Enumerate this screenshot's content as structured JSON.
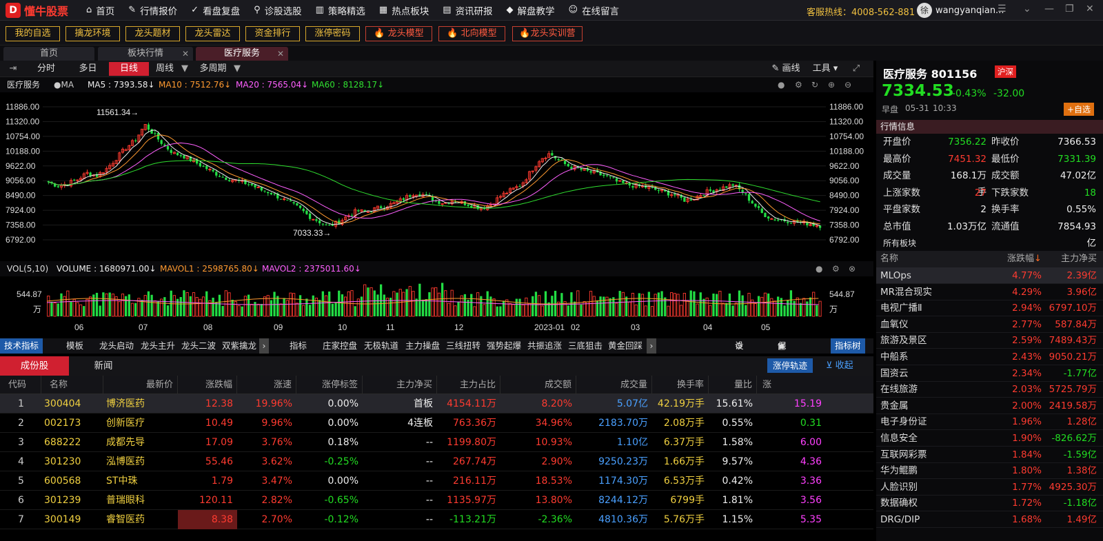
{
  "app": {
    "brand": "懂牛股票",
    "hotline": "客服热线：4008-562-881",
    "username": "wangyanqian...",
    "user_initial": "徐"
  },
  "nav": [
    "首页",
    "行情报价",
    "看盘复盘",
    "诊股选股",
    "策略精选",
    "热点板块",
    "资讯研报",
    "解盘教学",
    "在线留言"
  ],
  "tools": [
    "我的自选",
    "擒龙环境",
    "龙头题材",
    "龙头雷达",
    "资金排行",
    "涨停密码"
  ],
  "promo": [
    "龙头模型",
    "北向模型",
    "龙头实训营"
  ],
  "tabs": [
    "首页",
    "板块行情",
    "医疗服务"
  ],
  "periods": [
    "分时",
    "多日",
    "日线",
    "周线",
    "多周期"
  ],
  "chart_tools": [
    "画线",
    "工具"
  ],
  "ma": {
    "name": "医疗服务",
    "ma_label": "MA",
    "ma5": "MA5 : 7393.58↓",
    "ma10": "MA10 : 7512.76↓",
    "ma20": "MA20 : 7565.04↓",
    "ma60": "MA60 : 8128.17↓"
  },
  "vol": {
    "label": "VOL(5,10)",
    "volume": "VOLUME : 1680971.00↓",
    "mavol1": "MAVOL1 : 2598765.80↓",
    "mavol2": "MAVOL2 : 2375011.60↓",
    "axis_top": "544.87",
    "axis_unit": "万"
  },
  "chart_data": {
    "type": "candlestick",
    "y_ticks": [
      "11886.00",
      "11320.00",
      "10754.00",
      "10188.00",
      "9622.00",
      "9056.00",
      "8490.00",
      "7924.00",
      "7358.00",
      "6792.00"
    ],
    "ylim": [
      6792,
      11886
    ],
    "x_labels": [
      "06",
      "07",
      "08",
      "09",
      "10",
      "11",
      "12",
      "2023-01",
      "02",
      "03",
      "04",
      "05"
    ],
    "annotations": [
      "11561.34",
      "7033.33"
    ],
    "close_path": [
      9000,
      8850,
      8950,
      9100,
      9350,
      9250,
      9500,
      9900,
      10300,
      10600,
      11200,
      10800,
      10400,
      10100,
      10000,
      9800,
      9600,
      9400,
      9200,
      9100,
      9000,
      8900,
      8700,
      8600,
      8400,
      8200,
      8000,
      7700,
      7500,
      7300,
      7450,
      7700,
      7900,
      7850,
      8000,
      8100,
      8200,
      8400,
      8600,
      8500,
      8300,
      8200,
      8300,
      8200,
      8100,
      8000,
      8200,
      8500,
      8700,
      8900,
      9400,
      9900,
      10100,
      9800,
      9600,
      9500,
      9400,
      9300,
      9200,
      9000,
      8900,
      8850,
      8800,
      8700,
      8600,
      8500,
      8300,
      8400,
      8600,
      8700,
      8800,
      8900,
      8600,
      8200,
      7800,
      7600,
      7550,
      7500,
      7450,
      7400,
      7334
    ]
  },
  "indicators": {
    "title": "技术指标",
    "items": [
      "模板",
      "龙头启动",
      "龙头主升",
      "龙头二波",
      "双紫擒龙"
    ],
    "label2": "指标",
    "items2": [
      "庄家控盘",
      "无极轨道",
      "主力操盘",
      "三线扭转",
      "强势起爆",
      "共振追涨",
      "三底狙击",
      "黄金回踩"
    ],
    "settings": "设置",
    "save": "保存模板",
    "tree": "指标树"
  },
  "table_tabs": [
    "成份股",
    "新闻"
  ],
  "table_actions": {
    "limit": "涨停轨迹",
    "collapse": "收起"
  },
  "table_headers": [
    "代码",
    "名称",
    "最新价",
    "涨跌幅",
    "涨速",
    "涨停标签",
    "主力净买",
    "主力占比",
    "成交额",
    "成交量",
    "换手率",
    "量比",
    "涨"
  ],
  "rows": [
    {
      "i": "1",
      "code": "300404",
      "name": "博济医药",
      "price": "12.38",
      "chg": "19.96%",
      "spd": "0.00%",
      "tag": "首板",
      "net": "4154.11万",
      "ratio": "8.20%",
      "amt": "5.07亿",
      "vol": "42.19万手",
      "turn": "15.61%",
      "lb": "15.19"
    },
    {
      "i": "2",
      "code": "002173",
      "name": "创新医疗",
      "price": "10.49",
      "chg": "9.96%",
      "spd": "0.00%",
      "tag": "4连板",
      "net": "763.36万",
      "ratio": "34.96%",
      "amt": "2183.70万",
      "vol": "2.08万手",
      "turn": "0.55%",
      "lb": "0.31"
    },
    {
      "i": "3",
      "code": "688222",
      "name": "成都先导",
      "price": "17.09",
      "chg": "3.76%",
      "spd": "0.18%",
      "tag": "--",
      "net": "1199.80万",
      "ratio": "10.93%",
      "amt": "1.10亿",
      "vol": "6.37万手",
      "turn": "1.58%",
      "lb": "6.00"
    },
    {
      "i": "4",
      "code": "301230",
      "name": "泓博医药",
      "price": "55.46",
      "chg": "3.62%",
      "spd": "-0.25%",
      "tag": "--",
      "net": "267.74万",
      "ratio": "2.90%",
      "amt": "9250.23万",
      "vol": "1.66万手",
      "turn": "9.57%",
      "lb": "4.36"
    },
    {
      "i": "5",
      "code": "600568",
      "name": "ST中珠",
      "price": "1.79",
      "chg": "3.47%",
      "spd": "0.00%",
      "tag": "--",
      "net": "216.11万",
      "ratio": "18.53%",
      "amt": "1174.30万",
      "vol": "6.53万手",
      "turn": "0.42%",
      "lb": "3.36"
    },
    {
      "i": "6",
      "code": "301239",
      "name": "普瑞眼科",
      "price": "120.11",
      "chg": "2.82%",
      "spd": "-0.65%",
      "tag": "--",
      "net": "1135.97万",
      "ratio": "13.80%",
      "amt": "8244.12万",
      "vol": "6799手",
      "turn": "1.81%",
      "lb": "3.56"
    },
    {
      "i": "7",
      "code": "300149",
      "name": "睿智医药",
      "price": "8.38",
      "chg": "2.70%",
      "spd": "-0.12%",
      "tag": "--",
      "net": "-113.21万",
      "ratio": "-2.36%",
      "amt": "4810.36万",
      "vol": "5.76万手",
      "turn": "1.15%",
      "lb": "5.35"
    }
  ],
  "quote": {
    "name": "医疗服务 801156",
    "market": "沪深",
    "price": "7334.53",
    "pct": "-0.43%",
    "chg": "-32.00",
    "phase": "早盘",
    "date": "05-31",
    "time": "10:33",
    "add": "+自选"
  },
  "info_title": "行情信息",
  "info": [
    [
      "开盘价",
      "7356.22",
      "昨收价",
      "7366.53"
    ],
    [
      "最高价",
      "7451.32",
      "最低价",
      "7331.39"
    ],
    [
      "成交量",
      "168.1万手",
      "成交额",
      "47.02亿"
    ],
    [
      "上涨家数",
      "27",
      "下跌家数",
      "18"
    ],
    [
      "平盘家数",
      "2",
      "换手率",
      "0.55%"
    ],
    [
      "总市值",
      "1.03万亿",
      "流通值",
      "7854.93亿"
    ]
  ],
  "sector_title": "所有板块",
  "sector_headers": [
    "名称",
    "涨跌幅",
    "主力净买"
  ],
  "sectors": [
    [
      "MLOps",
      "4.77%",
      "2.39亿"
    ],
    [
      "MR混合现实",
      "4.29%",
      "3.96亿"
    ],
    [
      "电视广播Ⅱ",
      "2.94%",
      "6797.10万"
    ],
    [
      "血氧仪",
      "2.77%",
      "587.84万"
    ],
    [
      "旅游及景区",
      "2.59%",
      "7489.43万"
    ],
    [
      "中船系",
      "2.43%",
      "9050.21万"
    ],
    [
      "国资云",
      "2.34%",
      "-1.77亿"
    ],
    [
      "在线旅游",
      "2.03%",
      "5725.79万"
    ],
    [
      "贵金属",
      "2.00%",
      "2419.58万"
    ],
    [
      "电子身份证",
      "1.96%",
      "1.28亿"
    ],
    [
      "信息安全",
      "1.90%",
      "-826.62万"
    ],
    [
      "互联网彩票",
      "1.84%",
      "-1.59亿"
    ],
    [
      "华为鲲鹏",
      "1.80%",
      "1.38亿"
    ],
    [
      "人脸识别",
      "1.77%",
      "4925.30万"
    ],
    [
      "数据确权",
      "1.72%",
      "-1.18亿"
    ],
    [
      "DRG/DIP",
      "1.68%",
      "1.49亿"
    ]
  ]
}
